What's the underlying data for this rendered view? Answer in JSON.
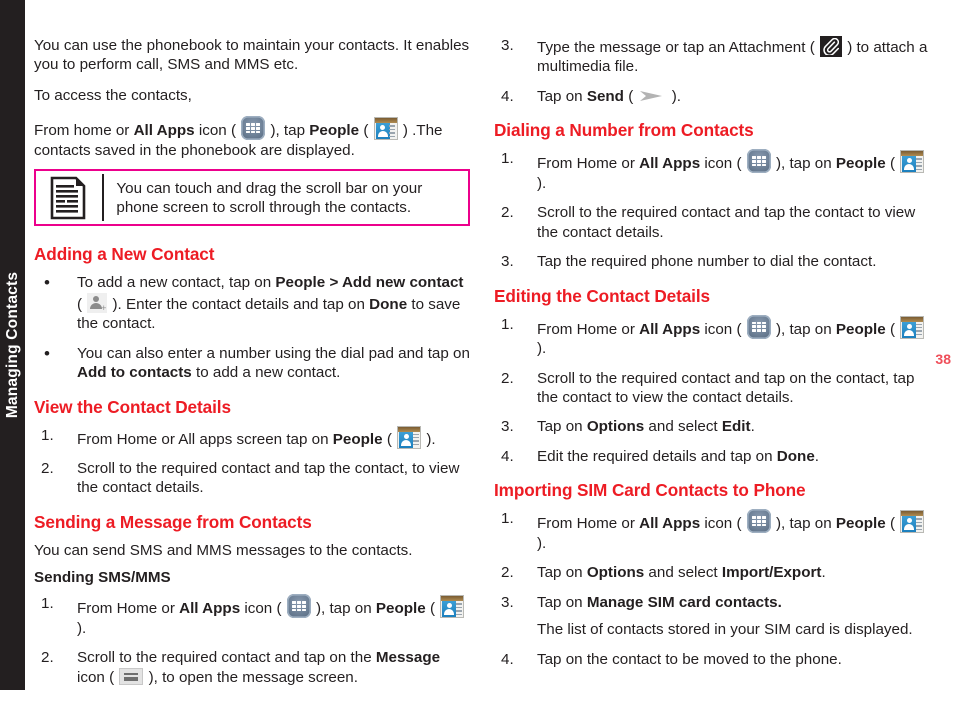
{
  "chapter_tab": {
    "label": "Managing Contacts"
  },
  "page_number": "38",
  "colors": {
    "heading_red": "#ed1c24",
    "note_border_magenta": "#ec008c",
    "tab_black": "#231f20",
    "page_number_red": "#ef4f5a"
  },
  "left_column": {
    "intro_paragraph_1": "You can use the phonebook to maintain your contacts. It enables you to perform call, SMS and MMS etc.",
    "intro_paragraph_2": "To access the contacts,",
    "access_line": {
      "part1": "From home or ",
      "bold1": "All Apps",
      "part2": " icon ( ",
      "icon1": "all-apps-icon",
      "part3": " ), tap ",
      "bold2": "People",
      "part4": " ( ",
      "icon2": "people-icon",
      "part5": " ) .The contacts saved in the phonebook are displayed."
    },
    "note": {
      "icon": "note-document-icon",
      "text": "You can touch and drag the scroll bar on your phone screen to scroll through the contacts."
    },
    "sections": [
      {
        "heading": "Adding a New Contact",
        "bullets": [
          {
            "marker": "•",
            "part1": "To add a new contact, tap on ",
            "bold1": "People > Add new contact",
            "part2": " ( ",
            "icon": "add-contact-icon",
            "part3": " ). Enter the contact details and tap on ",
            "bold2": "Done",
            "part4": " to save the contact."
          },
          {
            "marker": "•",
            "part1": "You can also enter a number using the dial pad and tap on ",
            "bold1": "Add to contacts",
            "part2": " to add a new contact."
          }
        ]
      },
      {
        "heading": "View the Contact Details",
        "steps": [
          {
            "marker": "1.",
            "part1": "From Home or All apps screen tap on ",
            "bold1": "People",
            "part2": " ( ",
            "icon": "people-icon",
            "part3": " )."
          },
          {
            "marker": "2.",
            "part1": "Scroll to the required contact and tap the contact, to view the contact details."
          }
        ]
      },
      {
        "heading": "Sending a Message from Contacts",
        "intro": "You can send SMS and MMS messages to the contacts.",
        "subhead": "Sending SMS/MMS",
        "steps": [
          {
            "marker": "1.",
            "part1": "From Home or ",
            "bold1": "All Apps",
            "part2": " icon ( ",
            "icon1": "all-apps-icon",
            "part3": " ), tap on ",
            "bold2": "People",
            "part4": " ( ",
            "icon2": "people-icon",
            "part5": " )."
          },
          {
            "marker": "2.",
            "part1": "Scroll to the required contact and tap on the ",
            "bold1": "Message",
            "part2": " icon ( ",
            "icon1": "message-icon",
            "part3": " ), to open the message screen."
          }
        ]
      }
    ]
  },
  "right_column": {
    "continued_steps": [
      {
        "marker": "3.",
        "part1": "Type the message or tap an Attachment ( ",
        "icon1": "attachment-icon",
        "part2": " ) to attach a multimedia file."
      },
      {
        "marker": "4.",
        "part1": "Tap on ",
        "bold1": "Send",
        "part2": " ( ",
        "icon1": "send-icon",
        "part3": " )."
      }
    ],
    "sections": [
      {
        "heading": "Dialing a Number from Contacts",
        "steps": [
          {
            "marker": "1.",
            "part1": "From Home or ",
            "bold1": "All Apps",
            "part2": " icon ( ",
            "icon1": "all-apps-icon",
            "part3": " ), tap on ",
            "bold2": "People",
            "part4": " ( ",
            "icon2": "people-icon",
            "part5": " )."
          },
          {
            "marker": "2.",
            "part1": "Scroll to the required contact and tap the contact to view the contact details."
          },
          {
            "marker": "3.",
            "part1": "Tap the required phone number to dial the contact."
          }
        ]
      },
      {
        "heading": "Editing the Contact Details",
        "steps": [
          {
            "marker": "1.",
            "part1": "From Home or ",
            "bold1": "All Apps",
            "part2": " icon ( ",
            "icon1": "all-apps-icon",
            "part3": " ), tap on ",
            "bold2": "People",
            "part4": " ( ",
            "icon2": "people-icon",
            "part5": " )."
          },
          {
            "marker": "2.",
            "part1": "Scroll to the required contact and tap on the contact, tap the contact to view the contact details."
          },
          {
            "marker": "3.",
            "part1": "Tap on ",
            "bold1": "Options",
            "part2": " and select ",
            "bold2": "Edit",
            "part3": "."
          },
          {
            "marker": "4.",
            "part1": "Edit the required details and tap on ",
            "bold1": "Done",
            "part2": "."
          }
        ]
      },
      {
        "heading": "Importing SIM Card Contacts to Phone",
        "steps": [
          {
            "marker": "1.",
            "part1": "From Home or ",
            "bold1": "All Apps",
            "part2": " icon ( ",
            "icon1": "all-apps-icon",
            "part3": " ), tap on ",
            "bold2": "People",
            "part4": " ( ",
            "icon2": "people-icon",
            "part5": " )."
          },
          {
            "marker": "2.",
            "part1": "Tap on ",
            "bold1": "Options",
            "part2": " and select ",
            "bold2": "Import/Export",
            "part3": "."
          },
          {
            "marker": "3.",
            "part1": "Tap on ",
            "bold1": "Manage SIM card contacts.",
            "part2": ""
          },
          {
            "marker": "",
            "continuation": true,
            "part1": "The list of contacts stored in your SIM card is displayed."
          },
          {
            "marker": "4.",
            "part1": "Tap on the contact to be moved to the phone."
          }
        ]
      }
    ]
  }
}
